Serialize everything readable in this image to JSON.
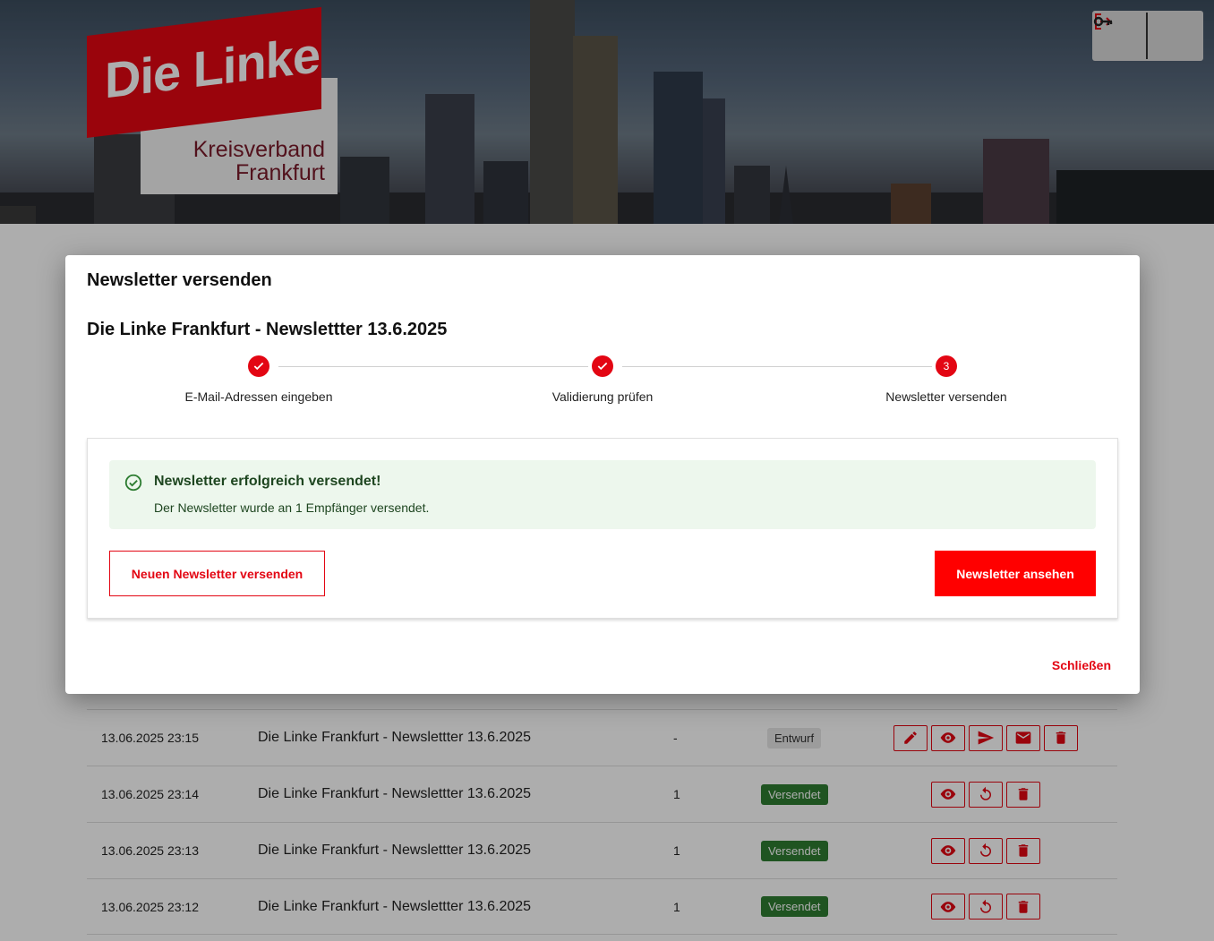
{
  "header": {
    "logo_main": "Die Linke",
    "logo_line1": "Kreisverband",
    "logo_line2": "Frankfurt",
    "icons": [
      "logout-icon",
      "key-icon"
    ]
  },
  "modal": {
    "title": "Newsletter versenden",
    "newsletter_title": "Die Linke Frankfurt - Newslettter 13.6.2025",
    "steps": [
      {
        "label": "E-Mail-Adressen eingeben",
        "state": "done"
      },
      {
        "label": "Validierung prüfen",
        "state": "done"
      },
      {
        "label": "Newsletter versenden",
        "state": "active",
        "number": "3"
      }
    ],
    "alert": {
      "heading": "Newsletter erfolgreich versendet!",
      "text": "Der Newsletter wurde an 1 Empfänger versendet."
    },
    "new_button": "Neuen Newsletter versenden",
    "view_button": "Newsletter ansehen",
    "close_button": "Schließen"
  },
  "list": {
    "rows": [
      {
        "date": "13.06.2025 23:15",
        "title": "Die Linke Frankfurt - Newslettter 13.6.2025",
        "count": "-",
        "status": "Entwurf"
      },
      {
        "date": "13.06.2025 23:14",
        "title": "Die Linke Frankfurt - Newslettter 13.6.2025",
        "count": "1",
        "status": "Versendet"
      },
      {
        "date": "13.06.2025 23:13",
        "title": "Die Linke Frankfurt - Newslettter 13.6.2025",
        "count": "1",
        "status": "Versendet"
      },
      {
        "date": "13.06.2025 23:12",
        "title": "Die Linke Frankfurt - Newslettter 13.6.2025",
        "count": "1",
        "status": "Versendet"
      }
    ]
  },
  "colors": {
    "brand_red": "#e30613",
    "success_green": "#2e7d32",
    "alert_bg": "#edf7ed"
  }
}
